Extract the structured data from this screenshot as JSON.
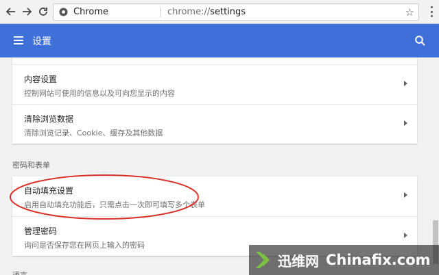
{
  "browser": {
    "site_label": "Chrome",
    "url_scheme": "chrome://",
    "url_path": "settings"
  },
  "header": {
    "title": "设置"
  },
  "cards": {
    "privacy": [
      {
        "title": "内容设置",
        "subtitle": "控制网站可使用的信息以及可向您显示的内容"
      },
      {
        "title": "清除浏览数据",
        "subtitle": "清除浏览记录、Cookie、缓存及其他数据"
      }
    ],
    "passwords_section_label": "密码和表单",
    "passwords": [
      {
        "title": "自动填充设置",
        "subtitle": "启用自动填充功能后，只需点击一次即可填写多个表单"
      },
      {
        "title": "管理密码",
        "subtitle": "询问是否保存您在网页上输入的密码"
      }
    ],
    "next_section_label": "语言"
  },
  "watermark": {
    "cn": "迅维网",
    "en": "Chinafix.com"
  },
  "colors": {
    "header_blue": "#3f6fd9",
    "annotation_red": "#d9322a"
  }
}
